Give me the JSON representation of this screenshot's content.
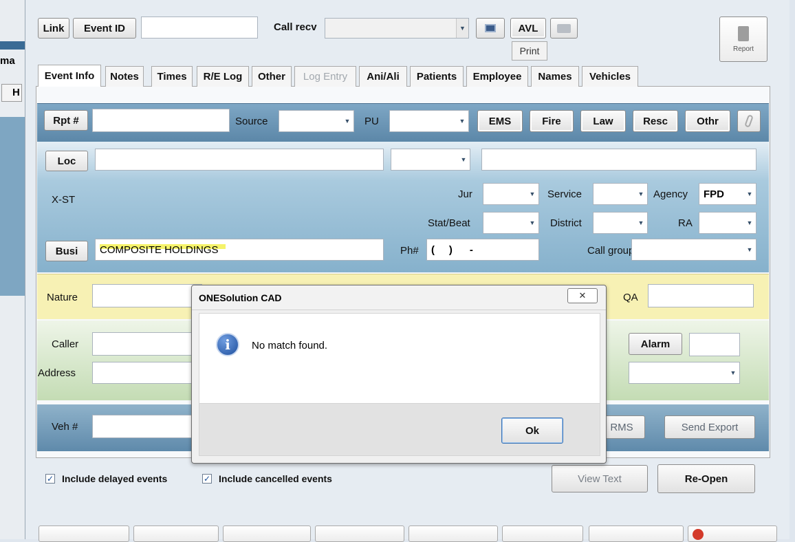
{
  "toolbar": {
    "link_label": "Link",
    "event_id_label": "Event ID",
    "event_id_value": "",
    "call_recv_label": "Call recv",
    "avl_label": "AVL",
    "print_label": "Print",
    "report_label": "Report"
  },
  "left_strip": {
    "cut_text_1": "ma",
    "cut_text_2": "H"
  },
  "tabs": [
    {
      "label": "Event Info",
      "state": "active"
    },
    {
      "label": "Notes",
      "state": "normal"
    },
    {
      "label": "Times",
      "state": "normal"
    },
    {
      "label": "R/E Log",
      "state": "normal"
    },
    {
      "label": "Other",
      "state": "normal"
    },
    {
      "label": "Log Entry",
      "state": "disabled"
    },
    {
      "label": "Ani/Ali",
      "state": "normal"
    },
    {
      "label": "Patients",
      "state": "normal"
    },
    {
      "label": "Employee",
      "state": "normal"
    },
    {
      "label": "Names",
      "state": "normal"
    },
    {
      "label": "Vehicles",
      "state": "normal"
    }
  ],
  "report_row": {
    "rpt_label": "Rpt #",
    "source_label": "Source",
    "pu_label": "PU",
    "ems_label": "EMS",
    "fire_label": "Fire",
    "law_label": "Law",
    "resc_label": "Resc",
    "othr_label": "Othr"
  },
  "location": {
    "loc_label": "Loc",
    "xst_label": "X-ST",
    "jur_label": "Jur",
    "service_label": "Service",
    "agency_label": "Agency",
    "agency_value": "FPD",
    "stat_beat_label": "Stat/Beat",
    "district_label": "District",
    "ra_label": "RA",
    "busi_label": "Busi",
    "busi_value": "COMPOSITE HOLDINGS",
    "ph_label": "Ph#",
    "ph_value": "(     )      -",
    "call_group_label": "Call group"
  },
  "nature": {
    "nature_label": "Nature",
    "qa_label": "QA"
  },
  "caller": {
    "caller_label": "Caller",
    "address_label": "Address",
    "alarm_label": "Alarm"
  },
  "vehicle": {
    "veh_label": "Veh #",
    "rms_label": "RMS",
    "send_export_label": "Send Export"
  },
  "footer": {
    "include_delayed_label": "Include delayed events",
    "include_cancelled_label": "Include cancelled events",
    "view_text_label": "View Text",
    "reopen_label": "Re-Open"
  },
  "dialog": {
    "title": "ONESolution CAD",
    "message": "No match found.",
    "ok_label": "Ok",
    "close_glyph": "✕",
    "icon": "info-icon"
  },
  "colors": {
    "blue_band": "#5d88a8",
    "blue_band_light": "#a8c9dd",
    "yellow_band": "#f7f1b4",
    "green_band": "#cfe3c2",
    "highlight": "#f5f36a"
  }
}
